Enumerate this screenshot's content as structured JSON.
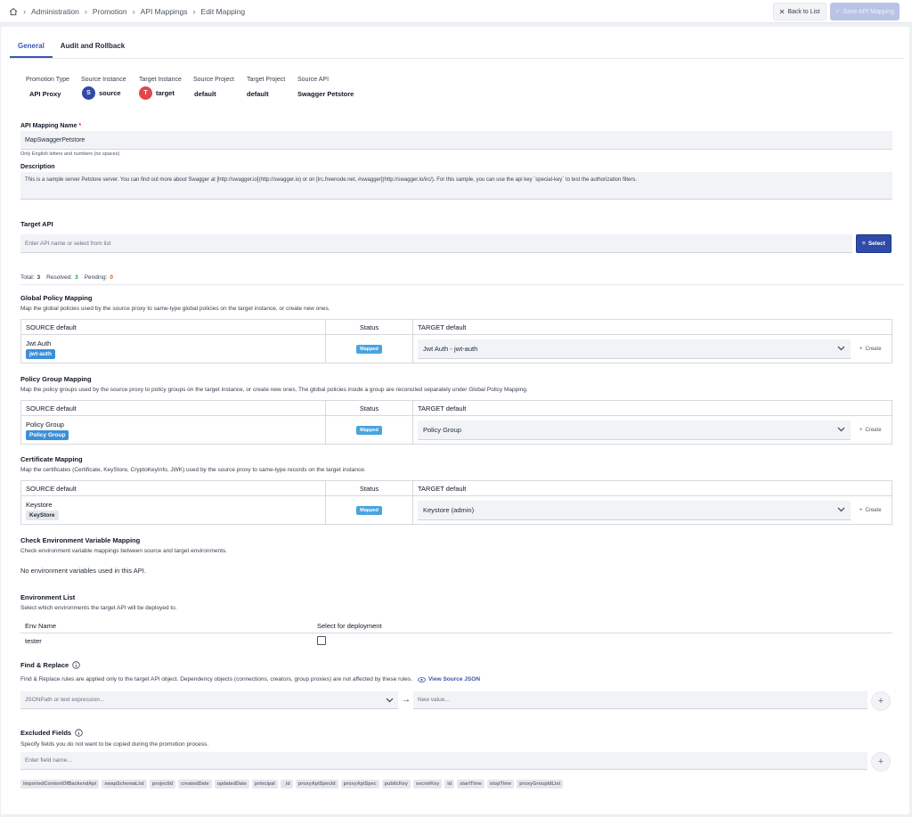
{
  "breadcrumb": [
    "Administration",
    "Promotion",
    "API Mappings",
    "Edit Mapping"
  ],
  "actions": {
    "back": "Back to List",
    "save": "Save API Mapping"
  },
  "tabs": [
    "General",
    "Audit and Rollback"
  ],
  "info": {
    "labels": [
      "Promotion Type",
      "Source Instance",
      "Target Instance",
      "Source Project",
      "Target Project",
      "Source API"
    ],
    "promotion_type": "API Proxy",
    "source_instance": {
      "initial": "S",
      "name": "source",
      "color": "#2f4aa8"
    },
    "target_instance": {
      "initial": "T",
      "name": "target",
      "color": "#e0474c"
    },
    "source_project": "default",
    "target_project": "default",
    "source_api": "Swagger Petstore"
  },
  "mapping_name": {
    "label": "API Mapping Name",
    "required": "*",
    "value": "MapSwaggerPetstore",
    "hint": "Only English letters and numbers (no spaces)"
  },
  "description": {
    "label": "Description",
    "value": "This is a sample server Petstore server.  You can find out more about Swagger at [http://swagger.io](http://swagger.io) or on [irc.freenode.net, #swagger](http://swagger.io/irc/).  For this sample, you can use the api key `special-key` to test the authorization filters."
  },
  "target_api": {
    "label": "Target API",
    "placeholder": "Enter API name or select from list",
    "select": "Select"
  },
  "summary": {
    "total_label": "Total:",
    "total": "3",
    "resolved_label": "Resolved:",
    "resolved": "3",
    "pending_label": "Pending:",
    "pending": "0"
  },
  "global_policy": {
    "title": "Global Policy Mapping",
    "desc": "Map the global policies used by the source proxy to same-type global policies on the target instance, or create new ones.",
    "headers": [
      "SOURCE default",
      "Status",
      "TARGET default"
    ],
    "source_name": "Jwt Auth",
    "source_tag": "jwt-auth",
    "status": "Mapped",
    "target": "Jwt Auth - jwt-auth",
    "create": "Create"
  },
  "policy_group": {
    "title": "Policy Group Mapping",
    "desc": "Map the policy groups used by the source proxy to policy groups on the target instance, or create new ones. The global policies inside a group are reconciled separately under Global Policy Mapping.",
    "headers": [
      "SOURCE default",
      "Status",
      "TARGET default"
    ],
    "source_name": "Policy Group",
    "source_tag": "Policy Group",
    "status": "Mapped",
    "target": "Policy Group",
    "create": "Create"
  },
  "certificate": {
    "title": "Certificate Mapping",
    "desc": "Map the certificates (Certificate, KeyStore, CryptoKeyInfo, JWK) used by the source proxy to same-type records on the target instance.",
    "headers": [
      "SOURCE default",
      "Status",
      "TARGET default"
    ],
    "source_name": "Keystore",
    "source_tag": "KeyStore",
    "status": "Mapped",
    "target": "Keystore (admin)",
    "create": "Create"
  },
  "env_var": {
    "title": "Check Environment Variable Mapping",
    "desc": "Check environment variable mappings between source and target environments.",
    "empty": "No environment variables used in this API."
  },
  "env_list": {
    "title": "Environment List",
    "desc": "Select which environments the target API will be deployed to.",
    "headers": [
      "Env Name",
      "Select for deployment"
    ],
    "row": "tester"
  },
  "find_replace": {
    "title": "Find & Replace",
    "desc": "Find & Replace rules are applied only to the target API object. Dependency objects (connections, creators, group proxies) are not affected by these rules.",
    "view_json": "View Source JSON",
    "path_placeholder": "JSONPath or text expression...",
    "value_placeholder": "New value..."
  },
  "excluded": {
    "title": "Excluded Fields",
    "desc": "Specify fields you do not want to be copied during the promotion process.",
    "placeholder": "Enter field name...",
    "chips": [
      "importedContentOfBackendApi",
      "swapSchemaList",
      "projectId",
      "createdDate",
      "updatedDate",
      "principal",
      "_id",
      "proxyApiSpecId",
      "proxyApiSpec",
      "publicKey",
      "secretKey",
      "id",
      "startTime",
      "stopTime",
      "proxyGroupIdList"
    ]
  },
  "colors": {
    "primary": "#2f4aa8",
    "mapped": "#4aa3df",
    "tag": "#3b8fd9",
    "resolved": "#16a34a",
    "pending": "#ea580c"
  }
}
